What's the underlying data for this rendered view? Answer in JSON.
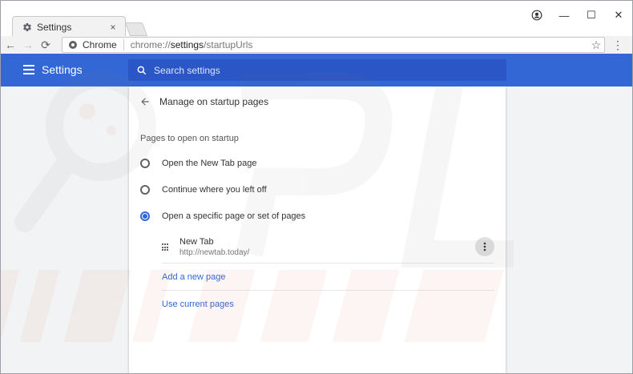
{
  "tab": {
    "title": "Settings",
    "close_label": "×"
  },
  "window_controls": {
    "minimize": "—",
    "maximize": "☐",
    "close": "✕"
  },
  "toolbar": {
    "back": "←",
    "forward": "→",
    "reload": "⟳",
    "site_label": "Chrome",
    "url_scheme": "chrome://",
    "url_host": "settings",
    "url_path": "/startupUrls",
    "star": "☆",
    "menu": "⋮"
  },
  "header": {
    "title": "Settings",
    "search_placeholder": "Search settings"
  },
  "subpage": {
    "title": "Manage on startup pages",
    "section_label": "Pages to open on startup",
    "options": [
      {
        "label": "Open the New Tab page",
        "checked": false
      },
      {
        "label": "Continue where you left off",
        "checked": false
      },
      {
        "label": "Open a specific page or set of pages",
        "checked": true
      }
    ],
    "pages": [
      {
        "title": "New Tab",
        "url": "http://newtab.today/"
      }
    ],
    "add_link": "Add a new page",
    "use_current_link": "Use current pages"
  },
  "colors": {
    "header_blue": "#3367d6",
    "search_blue": "#2a56c6",
    "link_blue": "#3367d6"
  }
}
